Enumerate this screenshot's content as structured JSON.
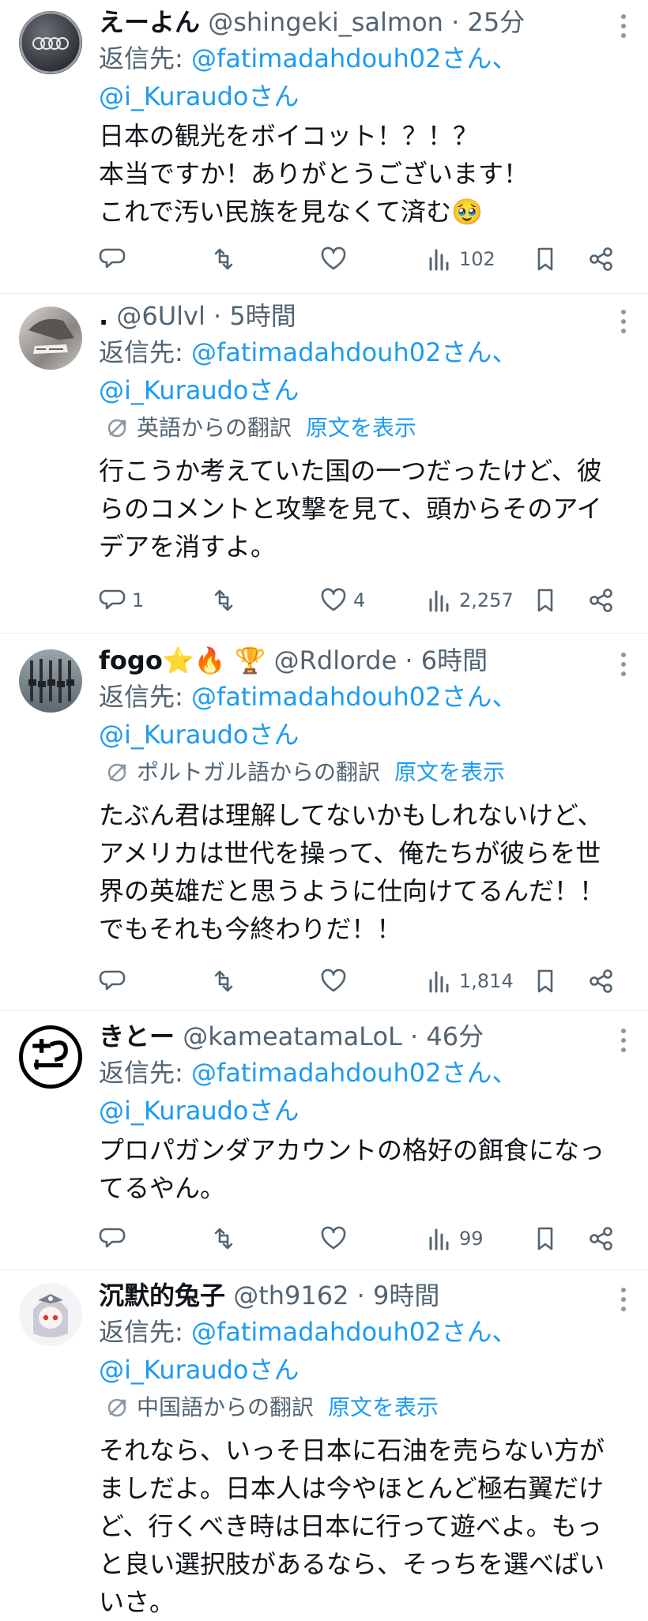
{
  "tweets": [
    {
      "name": "えーよん",
      "handle": "@shingeki_salmon",
      "time": "25分",
      "reply_prefix": "返信先: ",
      "reply_mention1": "@fatimadahdouh02さん、",
      "reply_mention2": "@i_Kuraudoさん",
      "body": "日本の観光をボイコット！？！？\n本当ですか！ありがとうございます！\nこれで汚い民族を見なくて済む🥹",
      "replies": "",
      "retweets": "",
      "likes": "",
      "views": "102"
    },
    {
      "name": ".",
      "handle": "@6Ulvl",
      "time": "5時間",
      "reply_prefix": "返信先: ",
      "reply_mention1": "@fatimadahdouh02さん、",
      "reply_mention2": "@i_Kuraudoさん",
      "translated_from": "英語からの翻訳",
      "show_original": "原文を表示",
      "body": "行こうか考えていた国の一つだったけど、彼\nらのコメントと攻撃を見て、頭からそのアイ\nデアを消すよ。",
      "replies": "1",
      "retweets": "",
      "likes": "4",
      "views": "2,257"
    },
    {
      "name": "fogo⭐🔥 🏆",
      "handle": "@Rdlorde",
      "time": "6時間",
      "reply_prefix": "返信先: ",
      "reply_mention1": "@fatimadahdouh02さん、",
      "reply_mention2": "@i_Kuraudoさん",
      "translated_from": "ポルトガル語からの翻訳",
      "show_original": "原文を表示",
      "body": "たぶん君は理解してないかもしれないけど、\nアメリカは世代を操って、俺たちが彼らを世\n界の英雄だと思うように仕向けてるんだ！！\nでもそれも今終わりだ！！",
      "replies": "",
      "retweets": "",
      "likes": "",
      "views": "1,814"
    },
    {
      "name": "きとー",
      "handle": "@kameatamaLoL",
      "time": "46分",
      "reply_prefix": "返信先: ",
      "reply_mention1": "@fatimadahdouh02さん、",
      "reply_mention2": "@i_Kuraudoさん",
      "body": "プロパガンダアカウントの格好の餌食になっ\nてるやん。",
      "replies": "",
      "retweets": "",
      "likes": "",
      "views": "99"
    },
    {
      "name": "沉默的兔子",
      "handle": "@th9162",
      "time": "9時間",
      "reply_prefix": "返信先: ",
      "reply_mention1": "@fatimadahdouh02さん、",
      "reply_mention2": "@i_Kuraudoさん",
      "translated_from": "中国語からの翻訳",
      "show_original": "原文を表示",
      "body": "それなら、いっそ日本に石油を売らない方が\nましだよ。日本人は今やほとんど極右翼だけ\nど、行くべき時は日本に行って遊べよ。もっ\nと良い選択肢があるなら、そっちを選べばい\nいさ。"
    }
  ],
  "sep": " · "
}
